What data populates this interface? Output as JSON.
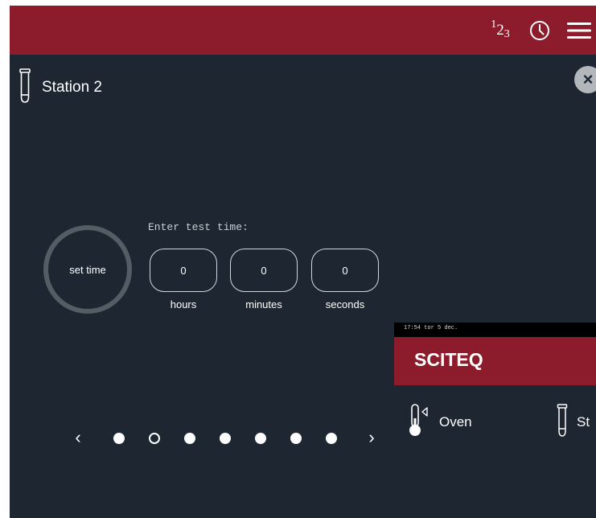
{
  "topbar": {
    "numbers_icon": {
      "d1": "1",
      "d2": "2",
      "d3": "3"
    },
    "icons": [
      "numbers-icon",
      "clock-icon",
      "menu-icon"
    ],
    "color": "#8c1c2c"
  },
  "station": {
    "title": "Station 2",
    "icon": "test-tube-icon"
  },
  "close_label": "×",
  "timer": {
    "button_label": "set time",
    "prompt": "Enter test time:",
    "fields": [
      {
        "value": "0",
        "label": "hours"
      },
      {
        "value": "0",
        "label": "minutes"
      },
      {
        "value": "0",
        "label": "seconds"
      }
    ]
  },
  "pager": {
    "prev": "‹",
    "next": "›",
    "total": 7,
    "current": 2
  },
  "overlay": {
    "status": "17:54  tor 5 dec.",
    "brand": "SCITEQ",
    "items": [
      {
        "label": "Oven",
        "icon": "thermometer-icon"
      },
      {
        "label": "St",
        "icon": "test-tube-icon"
      }
    ]
  }
}
